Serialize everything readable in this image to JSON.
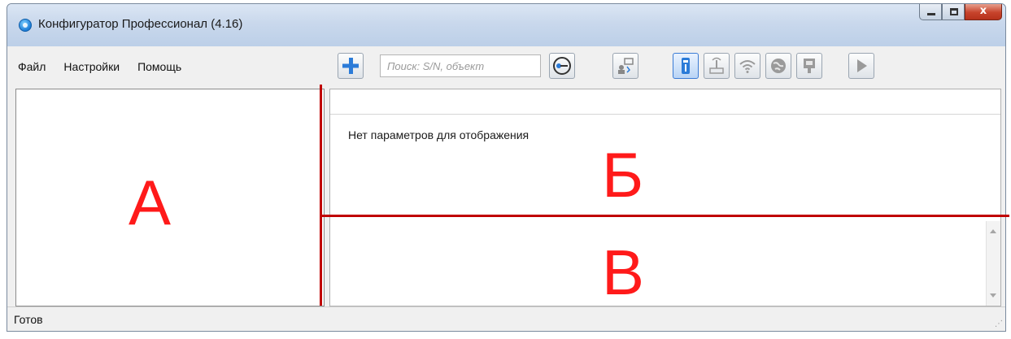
{
  "window": {
    "title": "Конфигуратор Профессионал (4.16)",
    "caption_minimize": "–",
    "caption_close": "x"
  },
  "menu": {
    "items": [
      {
        "label": "Файл"
      },
      {
        "label": "Настройки"
      },
      {
        "label": "Помощь"
      }
    ]
  },
  "toolbar": {
    "search_placeholder": "Поиск: S/N, объект",
    "buttons": [
      {
        "icon": "add-icon",
        "state": "enabled"
      },
      {
        "icon": "key-icon",
        "state": "enabled"
      },
      {
        "icon": "remote-connect-icon",
        "state": "enabled"
      },
      {
        "icon": "usb-icon",
        "state": "active"
      },
      {
        "icon": "modem-antenna-icon",
        "state": "disabled"
      },
      {
        "icon": "wifi-icon",
        "state": "disabled"
      },
      {
        "icon": "globe-icon",
        "state": "disabled"
      },
      {
        "icon": "ethernet-icon",
        "state": "disabled"
      },
      {
        "icon": "play-icon",
        "state": "disabled"
      }
    ]
  },
  "panels": {
    "left_letter": "А",
    "right_top_letter": "Б",
    "right_bottom_letter": "В",
    "params_empty_text": "Нет параметров для отображения"
  },
  "status": {
    "text": "Готов"
  },
  "colors": {
    "annotation_red": "#c00000",
    "letter_red": "#ff1a1a",
    "titlebar_blue": "#c9d8ec"
  }
}
